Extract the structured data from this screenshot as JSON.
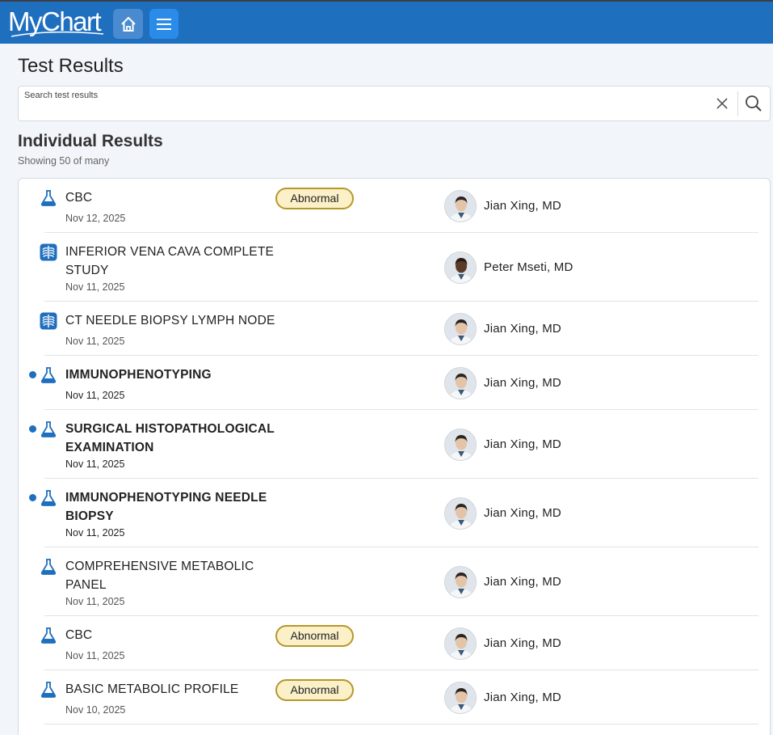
{
  "header": {
    "logo_text": "MyChart",
    "home_icon": "home-icon",
    "menu_icon": "hamburger-menu-icon",
    "colors": {
      "bar": "#1f6fbf",
      "home_button": "#4a8bd0",
      "menu_button": "#2a8ce8"
    }
  },
  "page": {
    "title": "Test Results"
  },
  "search": {
    "label": "Search test results",
    "value": ""
  },
  "section": {
    "title": "Individual Results",
    "subtitle": "Showing 50 of many"
  },
  "results": [
    {
      "name": "CBC",
      "date": "Nov 12, 2025",
      "badge": "Abnormal",
      "provider": "Jian Xing, MD",
      "icon": "lab-flask-icon",
      "unread": false
    },
    {
      "name": "INFERIOR VENA CAVA COMPLETE STUDY",
      "date": "Nov 11, 2025",
      "badge": "",
      "provider": "Peter Mseti, MD",
      "icon": "imaging-ribcage-icon",
      "unread": false
    },
    {
      "name": "CT NEEDLE BIOPSY LYMPH NODE",
      "date": "Nov 11, 2025",
      "badge": "",
      "provider": "Jian Xing, MD",
      "icon": "imaging-ribcage-icon",
      "unread": false
    },
    {
      "name": "IMMUNOPHENOTYPING",
      "date": "Nov 11, 2025",
      "badge": "",
      "provider": "Jian Xing, MD",
      "icon": "lab-flask-icon",
      "unread": true
    },
    {
      "name": "SURGICAL HISTOPATHOLOGICAL EXAMINATION",
      "date": "Nov 11, 2025",
      "badge": "",
      "provider": "Jian Xing, MD",
      "icon": "lab-flask-icon",
      "unread": true
    },
    {
      "name": "IMMUNOPHENOTYPING NEEDLE BIOPSY",
      "date": "Nov 11, 2025",
      "badge": "",
      "provider": "Jian Xing, MD",
      "icon": "lab-flask-icon",
      "unread": true
    },
    {
      "name": "COMPREHENSIVE METABOLIC PANEL",
      "date": "Nov 11, 2025",
      "badge": "",
      "provider": "Jian Xing, MD",
      "icon": "lab-flask-icon",
      "unread": false
    },
    {
      "name": "CBC",
      "date": "Nov 11, 2025",
      "badge": "Abnormal",
      "provider": "Jian Xing, MD",
      "icon": "lab-flask-icon",
      "unread": false
    },
    {
      "name": "BASIC METABOLIC PROFILE",
      "date": "Nov 10, 2025",
      "badge": "Abnormal",
      "provider": "Jian Xing, MD",
      "icon": "lab-flask-icon",
      "unread": false
    }
  ],
  "colors": {
    "accent": "#1f6fbf",
    "badge_border": "#b6972a",
    "badge_fill": "#fbf0c8"
  }
}
